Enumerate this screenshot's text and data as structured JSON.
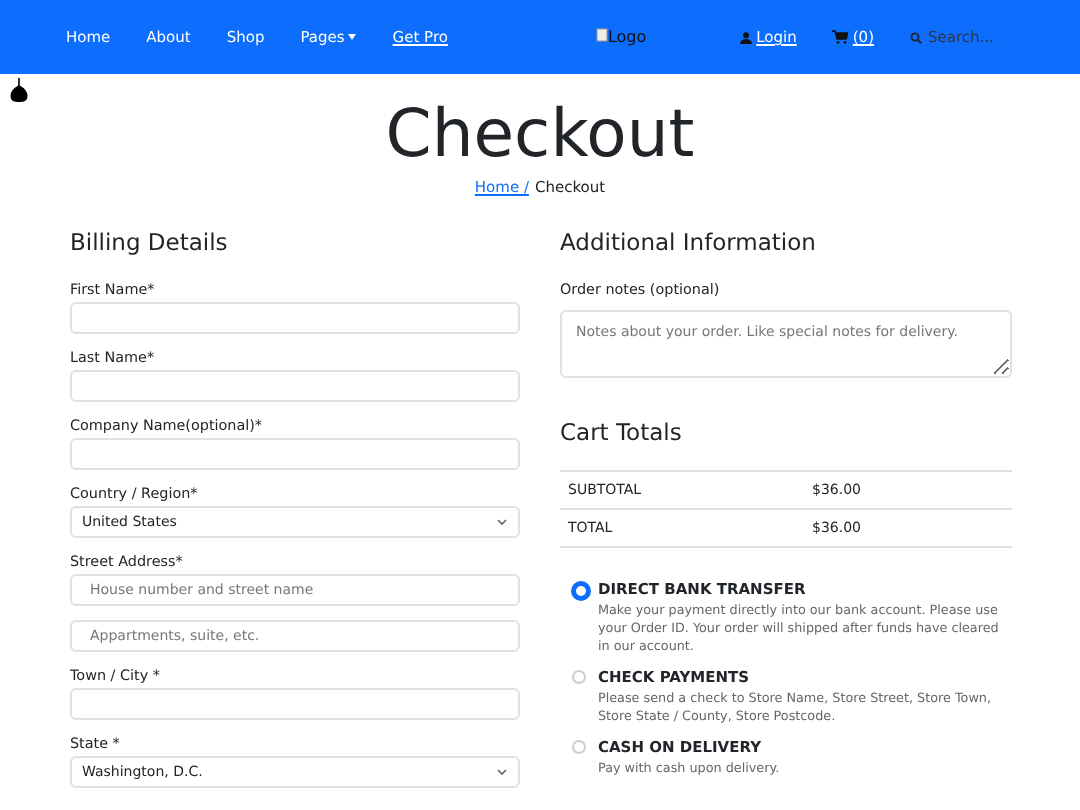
{
  "nav": {
    "items": [
      {
        "label": "Home",
        "kind": "plain"
      },
      {
        "label": "About",
        "kind": "plain"
      },
      {
        "label": "Shop",
        "kind": "plain"
      },
      {
        "label": "Pages",
        "kind": "dropdown"
      },
      {
        "label": "Get Pro",
        "kind": "underlined"
      }
    ],
    "logo": "Logo",
    "login": "Login",
    "cart": "(0)",
    "search": {
      "placeholder": "Search..."
    }
  },
  "page": {
    "title": "Checkout",
    "breadcrumb": [
      {
        "label": "Home /",
        "kind": "link"
      },
      {
        "label": "Checkout",
        "kind": "current"
      }
    ]
  },
  "billing": {
    "heading": "Billing Details",
    "fields": [
      {
        "label": "First Name*",
        "kind": "text"
      },
      {
        "label": "Last Name*",
        "kind": "text"
      },
      {
        "label": "Company Name(optional)*",
        "kind": "text"
      },
      {
        "label": "Country / Region*",
        "kind": "select",
        "value": "United States"
      },
      {
        "label": "Street Address*",
        "kind": "text",
        "placeholders": [
          "House number and street name",
          "Appartments, suite, etc."
        ]
      },
      {
        "label": "Town / City *",
        "kind": "text"
      },
      {
        "label": "State *",
        "kind": "select",
        "value": "Washington, D.C."
      }
    ]
  },
  "additional": {
    "heading": "Additional Information",
    "notes_label": "Order notes (optional)",
    "notes_placeholder": "Notes about your order. Like special notes for delivery."
  },
  "cart_totals": {
    "heading": "Cart Totals",
    "rows": [
      {
        "label": "SUBTOTAL",
        "value": "$36.00"
      },
      {
        "label": "TOTAL",
        "value": "$36.00"
      }
    ]
  },
  "payment_methods": [
    {
      "title": "DIRECT BANK TRANSFER",
      "description": "Make your payment directly into our bank account. Please use your Order ID. Your order will shipped after funds have cleared in our account.",
      "selected": true
    },
    {
      "title": "CHECK PAYMENTS",
      "description": "Please send a check to Store Name, Store Street, Store Town, Store State / County, Store Postcode.",
      "selected": false
    },
    {
      "title": "CASH ON DELIVERY",
      "description": "Pay with cash upon delivery.",
      "selected": false
    }
  ]
}
